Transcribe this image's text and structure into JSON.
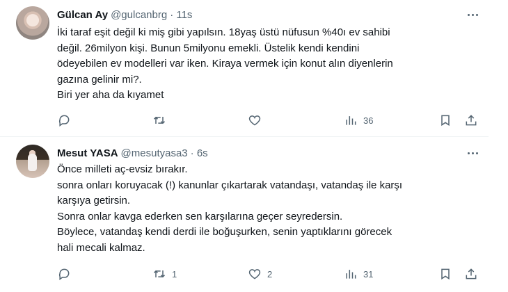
{
  "tweets": [
    {
      "name": "Gülcan Ay",
      "handle": "@gulcanbrg",
      "time": "· 11s",
      "lines": [
        "İki taraf eşit değil ki miş gibi yapılsın. 18yaş üstü nüfusun %40ı ev sahibi",
        "değil. 26milyon kişi. Bunun 5milyonu emekli. Üstelik kendi kendini",
        "ödeyebilen ev modelleri var iken. Kiraya vermek için konut alın diyenlerin",
        "gazına gelinir mi?.",
        "Biri yer aha da kıyamet"
      ],
      "counts": {
        "reply": "",
        "retweet": "",
        "like": "",
        "views": "36"
      }
    },
    {
      "name": "Mesut YASA",
      "handle": "@mesutyasa3",
      "time": "· 6s",
      "lines": [
        "Önce milleti aç-evsiz bırakır.",
        "sonra onları koruyacak (!) kanunlar çıkartarak vatandaşı, vatandaş ile karşı",
        "karşıya getirsin.",
        "Sonra onlar kavga ederken sen karşılarına geçer seyredersin.",
        "Böylece, vatandaş kendi derdi ile boğuşurken, senin yaptıklarını görecek",
        "hali mecali kalmaz."
      ],
      "counts": {
        "reply": "",
        "retweet": "1",
        "like": "2",
        "views": "31"
      }
    }
  ]
}
